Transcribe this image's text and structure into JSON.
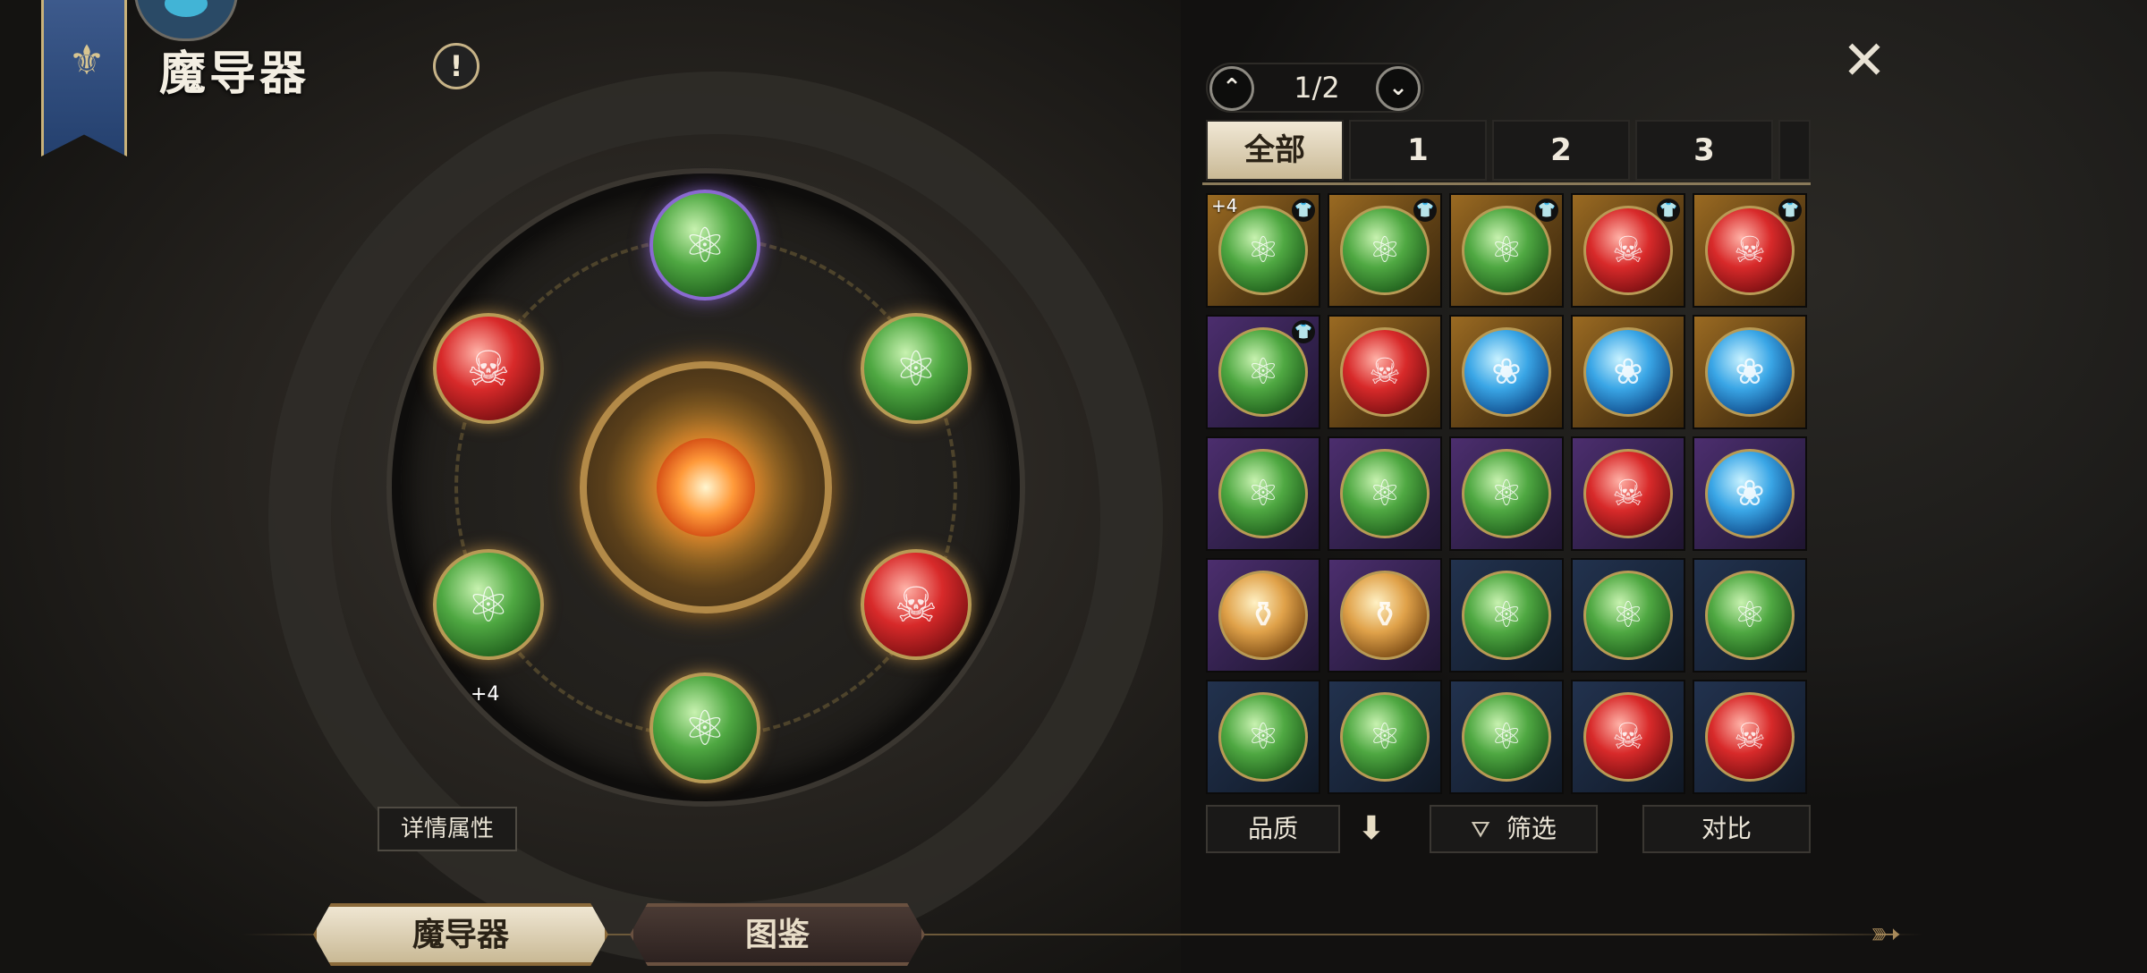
{
  "header": {
    "title": "魔导器",
    "info_symbol": "!",
    "banner_icon": "⚜",
    "close_symbol": "✕"
  },
  "wheel": {
    "slots": [
      {
        "name": "top",
        "gem": "green",
        "symbol": "⚛"
      },
      {
        "name": "upper-left",
        "gem": "red",
        "symbol": "☠"
      },
      {
        "name": "upper-right",
        "gem": "green",
        "symbol": "⚛"
      },
      {
        "name": "lower-left",
        "gem": "green",
        "symbol": "⚛"
      },
      {
        "name": "lower-right",
        "gem": "red",
        "symbol": "☠"
      },
      {
        "name": "bottom",
        "gem": "green",
        "symbol": "⚛"
      }
    ],
    "plus_label": "+4",
    "detail_button": "详情属性"
  },
  "pager": {
    "up_symbol": "⌃",
    "down_symbol": "⌄",
    "text": "1/2"
  },
  "tabs": [
    "全部",
    "1",
    "2",
    "3"
  ],
  "inventory": [
    {
      "quality": "gold",
      "gem": "green",
      "symbol": "⚛",
      "plus": "+4",
      "equipped": true
    },
    {
      "quality": "gold",
      "gem": "green",
      "symbol": "⚛",
      "equipped": true
    },
    {
      "quality": "gold",
      "gem": "green",
      "symbol": "⚛",
      "equipped": true
    },
    {
      "quality": "gold",
      "gem": "red",
      "symbol": "☠",
      "equipped": true
    },
    {
      "quality": "gold",
      "gem": "red",
      "symbol": "☠",
      "equipped": true
    },
    {
      "quality": "purple",
      "gem": "green",
      "symbol": "⚛",
      "equipped": true
    },
    {
      "quality": "gold",
      "gem": "red",
      "symbol": "☠"
    },
    {
      "quality": "gold",
      "gem": "blue",
      "symbol": "❀"
    },
    {
      "quality": "gold",
      "gem": "blue",
      "symbol": "❀"
    },
    {
      "quality": "gold",
      "gem": "blue",
      "symbol": "❀"
    },
    {
      "quality": "purple",
      "gem": "green",
      "symbol": "⚛"
    },
    {
      "quality": "purple",
      "gem": "green",
      "symbol": "⚛"
    },
    {
      "quality": "purple",
      "gem": "green",
      "symbol": "⚛"
    },
    {
      "quality": "purple",
      "gem": "red",
      "symbol": "☠"
    },
    {
      "quality": "purple",
      "gem": "blue",
      "symbol": "❀"
    },
    {
      "quality": "purple",
      "gem": "amber",
      "symbol": "⚱"
    },
    {
      "quality": "purple",
      "gem": "amber",
      "symbol": "⚱"
    },
    {
      "quality": "blue",
      "gem": "green",
      "symbol": "⚛"
    },
    {
      "quality": "blue",
      "gem": "green",
      "symbol": "⚛"
    },
    {
      "quality": "blue",
      "gem": "green",
      "symbol": "⚛"
    },
    {
      "quality": "blue",
      "gem": "green",
      "symbol": "⚛"
    },
    {
      "quality": "blue",
      "gem": "green",
      "symbol": "⚛"
    },
    {
      "quality": "blue",
      "gem": "green",
      "symbol": "⚛"
    },
    {
      "quality": "blue",
      "gem": "red",
      "symbol": "☠"
    },
    {
      "quality": "blue",
      "gem": "red",
      "symbol": "☠"
    }
  ],
  "equipped_icon": "👕",
  "bottom_bar": {
    "quality": "品质",
    "sort_symbol": "⬇",
    "filter": "筛选",
    "filter_icon": "⛛",
    "compare": "对比"
  },
  "bottom_tabs": {
    "active": "魔导器",
    "inactive": "图鉴"
  },
  "bow_icon": "➳"
}
